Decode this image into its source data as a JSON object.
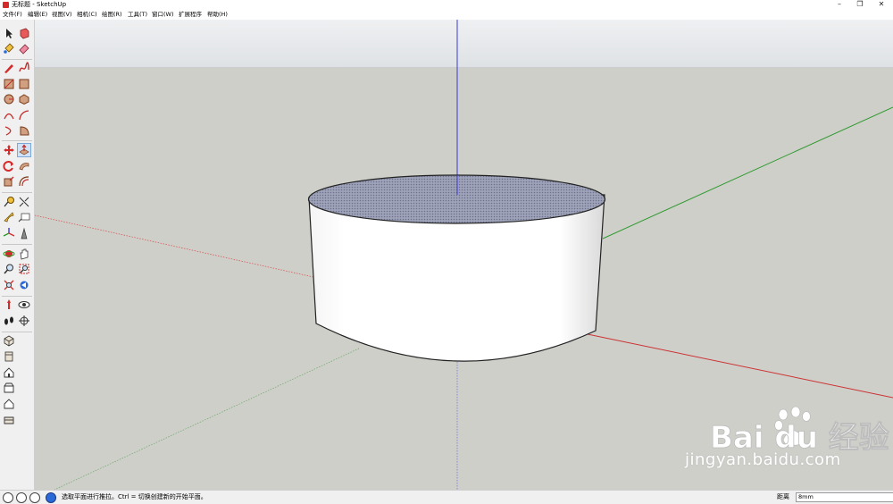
{
  "window": {
    "title": "无标题 - SketchUp",
    "controls": [
      "–",
      "❐",
      "✕"
    ]
  },
  "menubar": {
    "items": [
      {
        "label": "文件(F)"
      },
      {
        "label": "编辑(E)"
      },
      {
        "label": "视图(V)"
      },
      {
        "label": "相机(C)"
      },
      {
        "label": "绘图(R)"
      },
      {
        "label": "工具(T)"
      },
      {
        "label": "窗口(W)"
      },
      {
        "label": "扩展程序"
      },
      {
        "label": "帮助(H)"
      }
    ]
  },
  "toolbar": {
    "tools": [
      {
        "name": "select-tool",
        "icon": "arrow-icon"
      },
      {
        "name": "make-component-tool",
        "icon": "component-icon"
      },
      {
        "name": "paint-bucket-tool",
        "icon": "paint-bucket-icon"
      },
      {
        "name": "eraser-tool",
        "icon": "eraser-icon"
      },
      {
        "name": "line-tool",
        "icon": "pencil-icon"
      },
      {
        "name": "freehand-tool",
        "icon": "freehand-icon"
      },
      {
        "name": "rectangle-tool",
        "icon": "rectangle-icon"
      },
      {
        "name": "rotated-rectangle-tool",
        "icon": "rotated-rectangle-icon"
      },
      {
        "name": "circle-tool",
        "icon": "circle-icon"
      },
      {
        "name": "polygon-tool",
        "icon": "polygon-icon"
      },
      {
        "name": "arc-tool",
        "icon": "arc-icon"
      },
      {
        "name": "two-point-arc-tool",
        "icon": "arc-2pt-icon"
      },
      {
        "name": "three-point-arc-tool",
        "icon": "arc-3pt-icon"
      },
      {
        "name": "pie-tool",
        "icon": "pie-icon"
      },
      {
        "name": "move-tool",
        "icon": "move-icon"
      },
      {
        "name": "push-pull-tool",
        "icon": "push-pull-icon"
      },
      {
        "name": "rotate-tool",
        "icon": "rotate-icon"
      },
      {
        "name": "follow-me-tool",
        "icon": "follow-me-icon"
      },
      {
        "name": "scale-tool",
        "icon": "scale-icon"
      },
      {
        "name": "offset-tool",
        "icon": "offset-icon"
      },
      {
        "name": "tape-measure-tool",
        "icon": "tape-measure-icon"
      },
      {
        "name": "dimension-tool",
        "icon": "dimension-icon"
      },
      {
        "name": "protractor-tool",
        "icon": "protractor-icon"
      },
      {
        "name": "text-tool",
        "icon": "text-icon"
      },
      {
        "name": "axes-tool",
        "icon": "axes-icon"
      },
      {
        "name": "3d-text-tool",
        "icon": "3d-text-icon"
      },
      {
        "name": "orbit-tool",
        "icon": "orbit-icon"
      },
      {
        "name": "pan-tool",
        "icon": "hand-icon"
      },
      {
        "name": "zoom-tool",
        "icon": "magnifier-icon"
      },
      {
        "name": "zoom-window-tool",
        "icon": "zoom-window-icon"
      },
      {
        "name": "zoom-extents-tool",
        "icon": "zoom-extents-icon"
      },
      {
        "name": "previous-view-tool",
        "icon": "previous-view-icon"
      },
      {
        "name": "position-camera-tool",
        "icon": "camera-position-icon"
      },
      {
        "name": "look-around-tool",
        "icon": "eye-icon"
      },
      {
        "name": "walk-tool",
        "icon": "footprints-icon"
      },
      {
        "name": "section-plane-tool",
        "icon": "section-plane-icon"
      },
      {
        "name": "iso-view",
        "icon": "iso-view-icon"
      },
      {
        "name": "top-view",
        "icon": "top-view-icon"
      },
      {
        "name": "front-view",
        "icon": "front-view-icon"
      },
      {
        "name": "right-view",
        "icon": "right-view-icon"
      },
      {
        "name": "back-view",
        "icon": "back-view-icon"
      },
      {
        "name": "left-view",
        "icon": "left-view-icon"
      }
    ]
  },
  "scene": {
    "colors": {
      "ground": "#cfcfca",
      "sky": "#e6e9ec",
      "axis_red": "#d43a3a",
      "axis_green": "#2f9a2f",
      "axis_blue": "#3a3ad8",
      "face_top": "#9aa0b8",
      "cylinder_side": "#ffffff",
      "edge": "#222222"
    }
  },
  "watermark": {
    "brand": "Bai du 经验",
    "url": "jingyan.baidu.com"
  },
  "status": {
    "message": "选取平面进行推拉。Ctrl = 切换创建新的开始平面。",
    "measure_label": "距离",
    "measure_value": "8mm",
    "icons": [
      "geo-location-icon",
      "credits-icon",
      "user-icon",
      "help-icon"
    ]
  }
}
